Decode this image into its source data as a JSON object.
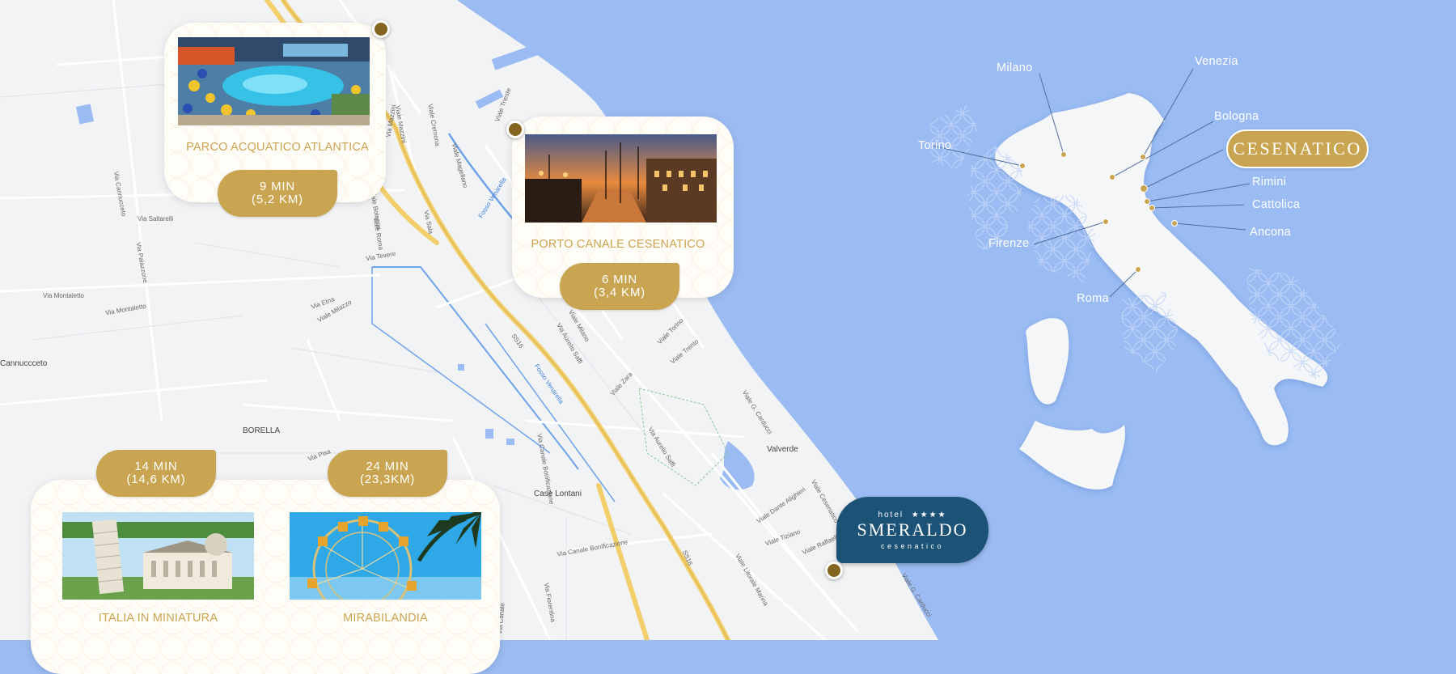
{
  "map": {
    "place_labels": [
      "Cannuccceto",
      "BORELLA",
      "Case Lontani",
      "Valverde"
    ],
    "street_labels": [
      "Fosso Venarella",
      "Fosso Venarella",
      "SS16",
      "SS16",
      "Via Aurelio Saffi",
      "Via Aurelio Saffi",
      "Viale G. Carducci",
      "Viale G. Carducci",
      "Viale Litorale Marina",
      "Via Canale Bonificazione",
      "Via Montaletto",
      "Via Palazzone",
      "Via Saltarelli",
      "Via Cannucceto",
      "Viale Cremona",
      "Viale Magellano",
      "Via Sala",
      "Viale Torino",
      "Viale Zara",
      "Viale Milano",
      "Viale Trento",
      "Via Tevere",
      "Viale Roma",
      "Via Mazzini",
      "Viale Milazzo",
      "Viale Bologna",
      "Via Montaletto",
      "Viale Trieste",
      "Via Canale Bonificazione",
      "Viale Dante Alighieri",
      "Viale Tiziano",
      "Viale Raffaello",
      "Via Etna",
      "Viale Cesenatico",
      "Via Pisa",
      "Viale Mazzini",
      "Via Canale",
      "Via Fiorentina"
    ]
  },
  "destinations": [
    {
      "title": "PARCO ACQUATICO ATLANTICA",
      "time": "9 MIN",
      "distance": "(5,2 KM)"
    },
    {
      "title": "PORTO CANALE CESENATICO",
      "time": "6 MIN",
      "distance": "(3,4 KM)"
    },
    {
      "title": "ITALIA IN MINIATURA",
      "time": "14 MIN",
      "distance": "(14,6 KM)"
    },
    {
      "title": "MIRABILANDIA",
      "time": "24 MIN",
      "distance": "(23,3KM)"
    }
  ],
  "hotel": {
    "prefix": "hotel",
    "stars": "★★★★",
    "name": "SMERALDO",
    "town": "cesenatico"
  },
  "italy": {
    "highlight": "CESENATICO",
    "cities": [
      "Milano",
      "Venezia",
      "Bologna",
      "Torino",
      "Rimini",
      "Cattolica",
      "Ancona",
      "Firenze",
      "Roma"
    ]
  },
  "colors": {
    "gold": "#c9a552",
    "pin": "#846421",
    "navy": "#1c5275",
    "sea": "#9bbcf3",
    "land": "#f2f3f5",
    "road": "#f3cf6b",
    "canal": "#6ea3ea"
  }
}
